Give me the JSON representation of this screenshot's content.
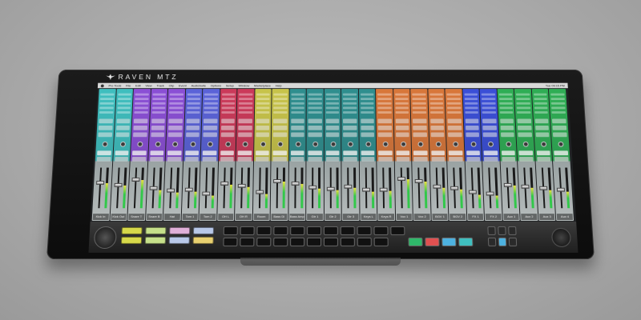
{
  "device": {
    "brand": "RAVEN MTZ",
    "logo_icon": "raven-bird-icon"
  },
  "menubar": {
    "items": [
      "Pro Tools",
      "File",
      "Edit",
      "View",
      "Track",
      "Clip",
      "Event",
      "AudioSuite",
      "Options",
      "Setup",
      "Window",
      "Marketplace",
      "Help"
    ],
    "clock": "Tue 09:15 PM"
  },
  "strips": [
    {
      "color": "#3fbfbf",
      "name": "Kick In",
      "level": 0.62
    },
    {
      "color": "#3fbfbf",
      "name": "Kick Out",
      "level": 0.55
    },
    {
      "color": "#8b4fd6",
      "name": "Snare T",
      "level": 0.7
    },
    {
      "color": "#8b4fd6",
      "name": "Snare B",
      "level": 0.45
    },
    {
      "color": "#8b4fd6",
      "name": "Hat",
      "level": 0.38
    },
    {
      "color": "#5b63d9",
      "name": "Tom 1",
      "level": 0.4
    },
    {
      "color": "#5b63d9",
      "name": "Tom 2",
      "level": 0.3
    },
    {
      "color": "#cc3a5a",
      "name": "OH L",
      "level": 0.58
    },
    {
      "color": "#cc3a5a",
      "name": "OH R",
      "level": 0.52
    },
    {
      "color": "#c8c44a",
      "name": "Room",
      "level": 0.35
    },
    {
      "color": "#c8c44a",
      "name": "Bass DI",
      "level": 0.66
    },
    {
      "color": "#2f8f8f",
      "name": "Bass Amp",
      "level": 0.6
    },
    {
      "color": "#2f8f8f",
      "name": "Gtr 1",
      "level": 0.48
    },
    {
      "color": "#2f8f8f",
      "name": "Gtr 2",
      "level": 0.44
    },
    {
      "color": "#2f8f8f",
      "name": "Gtr 3",
      "level": 0.5
    },
    {
      "color": "#2f8f8f",
      "name": "Keys L",
      "level": 0.4
    },
    {
      "color": "#d9773a",
      "name": "Keys R",
      "level": 0.42
    },
    {
      "color": "#d9773a",
      "name": "Vox 1",
      "level": 0.72
    },
    {
      "color": "#d9773a",
      "name": "Vox 2",
      "level": 0.65
    },
    {
      "color": "#d9773a",
      "name": "BGV 1",
      "level": 0.5
    },
    {
      "color": "#d9773a",
      "name": "BGV 2",
      "level": 0.46
    },
    {
      "color": "#3b4fd8",
      "name": "FX 1",
      "level": 0.33
    },
    {
      "color": "#3b4fd8",
      "name": "FX 2",
      "level": 0.3
    },
    {
      "color": "#2fae55",
      "name": "Aux 1",
      "level": 0.55
    },
    {
      "color": "#2fae55",
      "name": "Aux 2",
      "level": 0.5
    },
    {
      "color": "#2fae55",
      "name": "Aux 3",
      "level": 0.45
    },
    {
      "color": "#2fae55",
      "name": "Aux 4",
      "level": 0.4
    }
  ],
  "batch": {
    "wheel_icon": "jog-wheel-icon",
    "function_buttons": [
      {
        "label": "",
        "color": "#d7d94a"
      },
      {
        "label": "",
        "color": "#d7d94a"
      },
      {
        "label": "",
        "color": "#c6e08a"
      },
      {
        "label": "",
        "color": "#c6e08a"
      },
      {
        "label": "",
        "color": "#e0b0d8"
      },
      {
        "label": "",
        "color": "#b8c8e8"
      },
      {
        "label": "",
        "color": "#b8c8e8"
      },
      {
        "label": "",
        "color": "#e8d070"
      }
    ],
    "tool_buttons": [
      "",
      "",
      "",
      "",
      "",
      "",
      "",
      "",
      "",
      "",
      "",
      "",
      "",
      "",
      "",
      "",
      "",
      "",
      "",
      "",
      ""
    ],
    "accent_buttons": [
      {
        "color": "#2fb86a"
      },
      {
        "color": "#e05050"
      },
      {
        "color": "#4db2e0"
      },
      {
        "color": "#3fbfbf"
      }
    ],
    "right_wheel_icon": "scroll-wheel-icon"
  }
}
